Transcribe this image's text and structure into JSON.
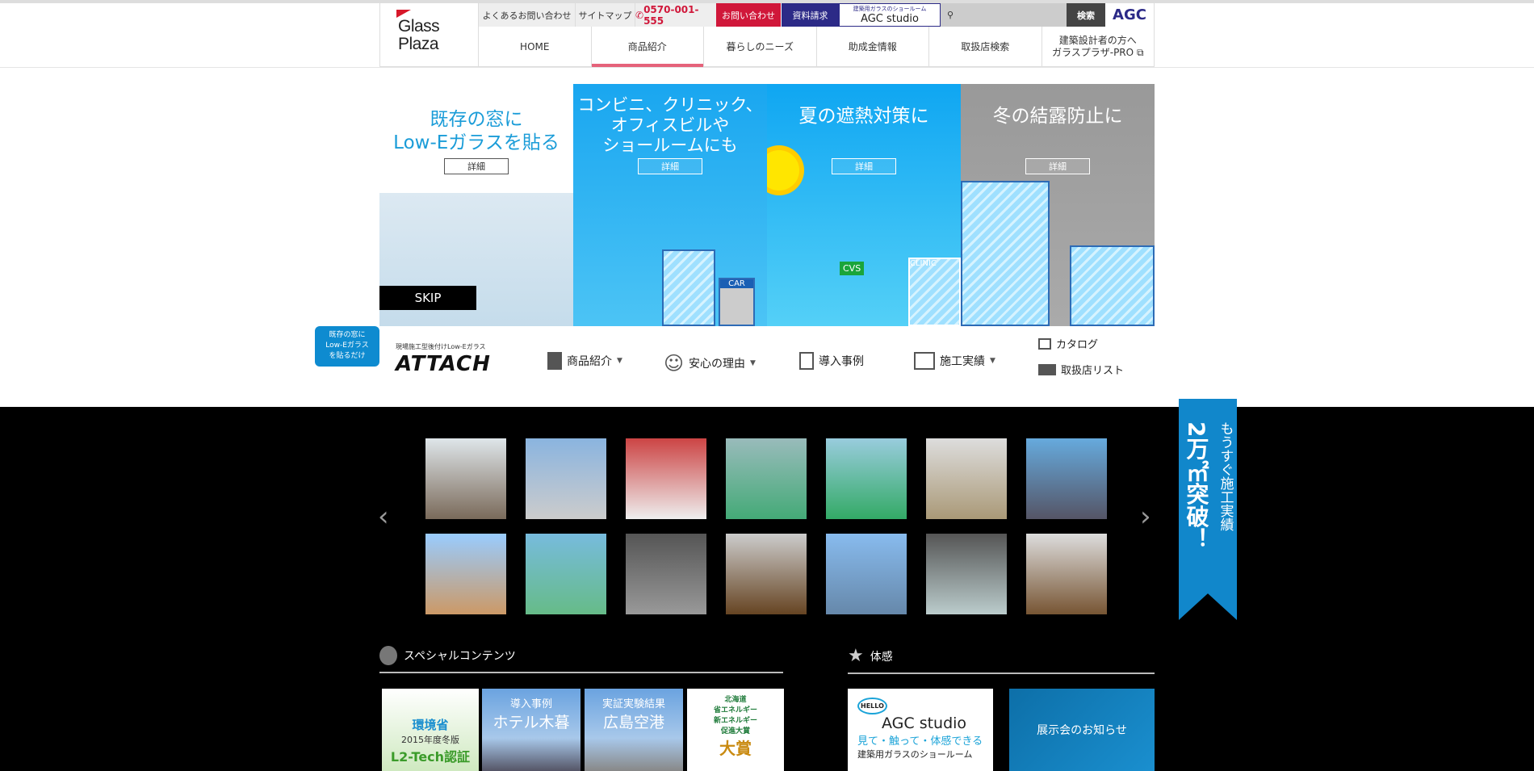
{
  "header": {
    "logo_line1": "Glass",
    "logo_line2": "Plaza",
    "utility": {
      "faq": "よくあるお問い合わせ",
      "sitemap": "サイトマップ",
      "phone": "0570-001-555",
      "contact": "お問い合わせ",
      "docs": "資料請求",
      "studio_sub": "建築用ガラスのショールーム",
      "studio": "AGC studio",
      "search_placeholder": "",
      "search_button": "検索",
      "brand": "AGC"
    },
    "nav": [
      "HOME",
      "商品紹介",
      "暮らしのニーズ",
      "助成金情報",
      "取扱店検索"
    ],
    "nav_pro_line1": "建築設計者の方へ",
    "nav_pro_line2": "ガラスプラザ-PRO",
    "active_nav": "商品紹介"
  },
  "hero": {
    "panels": [
      {
        "title": [
          "既存の窓に",
          "Low-Eガラスを貼る"
        ],
        "button": "詳細"
      },
      {
        "title": [
          "コンビニ、クリニック、",
          "オフィスビルや",
          "ショールームにも"
        ],
        "button": "詳細"
      },
      {
        "title": [
          "夏の遮熱対策に"
        ],
        "button": "詳細"
      },
      {
        "title": [
          "冬の結露防止に"
        ],
        "button": "詳細"
      }
    ],
    "skip": "SKIP",
    "signs": {
      "car": "CAR",
      "cvs": "CVS",
      "clinic": "CLINIC"
    }
  },
  "subnav": {
    "bubble": [
      "既存の窓に",
      "Low-Eガラス",
      "を貼るだけ"
    ],
    "tagline": "現場施工型後付けLow-Eガラス",
    "brand": "ATTACH",
    "items": [
      "商品紹介",
      "安心の理由",
      "導入事例",
      "施工実績"
    ],
    "catalog": "カタログ",
    "stores": "取扱店リスト"
  },
  "gallery": {
    "rows": 2,
    "per_row": 7
  },
  "ribbon": {
    "line1": "もうすぐ施工実績",
    "line2": "2万㎡突破！"
  },
  "special": {
    "title": "スペシャルコンテンツ",
    "cards": [
      {
        "lines": [
          "環境省",
          "2015年度冬版",
          "L2-Tech認証"
        ]
      },
      {
        "lines": [
          "導入事例",
          "ホテル木暮"
        ]
      },
      {
        "lines": [
          "実証実験結果",
          "広島空港"
        ]
      },
      {
        "lines": [
          "北海道",
          "省エネルギー",
          "新エネルギー",
          "促進大賞",
          "大賞"
        ]
      }
    ]
  },
  "experience": {
    "title": "体感",
    "studio": {
      "logo": "HELLO",
      "name": "AGC studio",
      "tag": "見て・触って・体感できる",
      "sub": "建築用ガラスのショールーム"
    },
    "exhibition": "展示会のお知らせ"
  },
  "colors": {
    "accent": "#d0173a",
    "navy": "#2c2a87",
    "ribbon": "#1187cb",
    "active": "#e5627a"
  }
}
